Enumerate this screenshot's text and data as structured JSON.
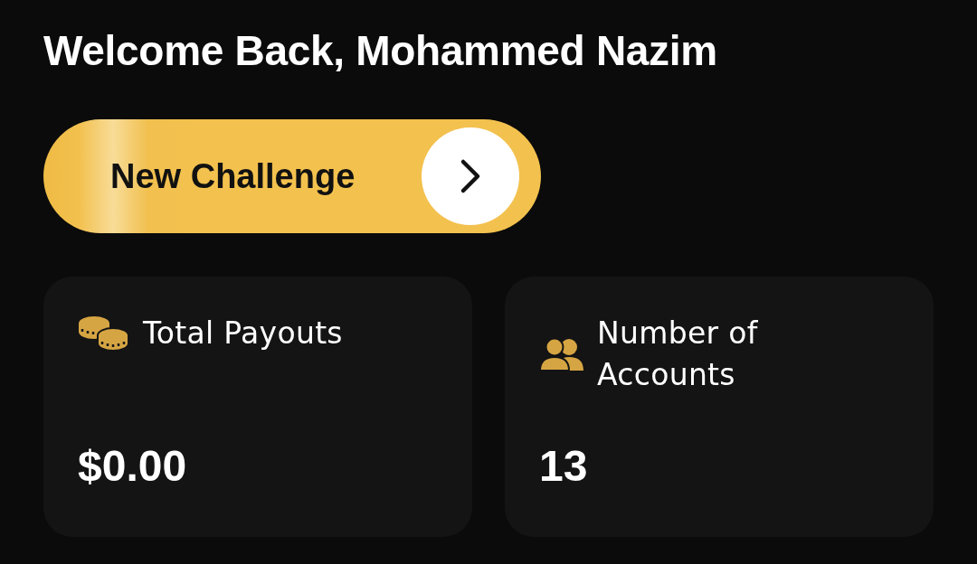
{
  "greeting": "Welcome Back, Mohammed Nazim",
  "new_challenge_button": {
    "label": "New Challenge"
  },
  "stats": [
    {
      "kind": "payouts",
      "label": "Total Payouts",
      "value": "$0.00"
    },
    {
      "kind": "accounts",
      "label": "Number of Accounts",
      "value": "13"
    }
  ]
}
